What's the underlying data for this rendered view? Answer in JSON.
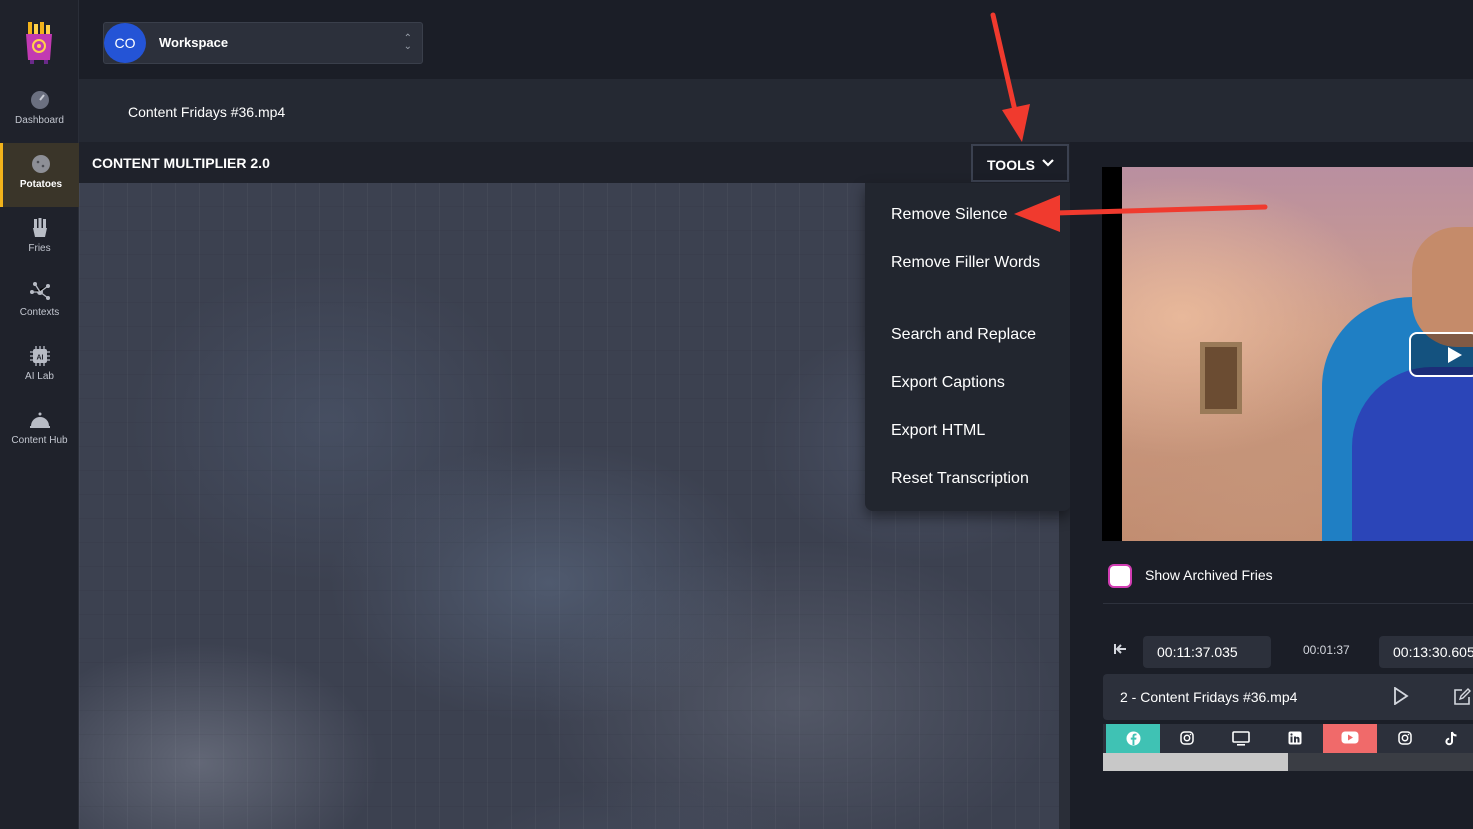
{
  "sidebar": {
    "items": [
      {
        "label": "Dashboard",
        "icon": "gauge-icon"
      },
      {
        "label": "Potatoes",
        "icon": "potato-icon"
      },
      {
        "label": "Fries",
        "icon": "fries-icon"
      },
      {
        "label": "Contexts",
        "icon": "network-icon"
      },
      {
        "label": "AI Lab",
        "icon": "ai-chip-icon"
      },
      {
        "label": "Content Hub",
        "icon": "cloche-icon"
      }
    ],
    "active": "Potatoes"
  },
  "workspace": {
    "initials": "CO",
    "name": "Workspace"
  },
  "file": {
    "name": "Content Fridays #36.mp4"
  },
  "panel": {
    "title": "CONTENT MULTIPLIER 2.0",
    "tools_label": "TOOLS"
  },
  "tools_menu": {
    "items": [
      "Remove Silence",
      "Remove Filler Words",
      "Search and Replace",
      "Export Captions",
      "Export HTML",
      "Reset Transcription"
    ]
  },
  "archived": {
    "label": "Show Archived Fries",
    "checked": false
  },
  "clip": {
    "start": "00:11:37.035",
    "duration": "00:01:37",
    "end": "00:13:30.605",
    "title": "2 - Content Fridays #36.mp4",
    "progress_fraction": 0.5
  },
  "social": [
    "facebook-icon",
    "instagram-icon",
    "desktop-icon",
    "linkedin-icon",
    "youtube-icon",
    "instagram-icon",
    "tiktok-icon"
  ],
  "colors": {
    "accent": "#f2b31b",
    "annotation_arrow": "#f03a2e",
    "facebook_bg": "#3fc2b4",
    "youtube_bg": "#f06a6a",
    "avatar": "#2454d6",
    "checkbox_border": "#d23db3"
  }
}
